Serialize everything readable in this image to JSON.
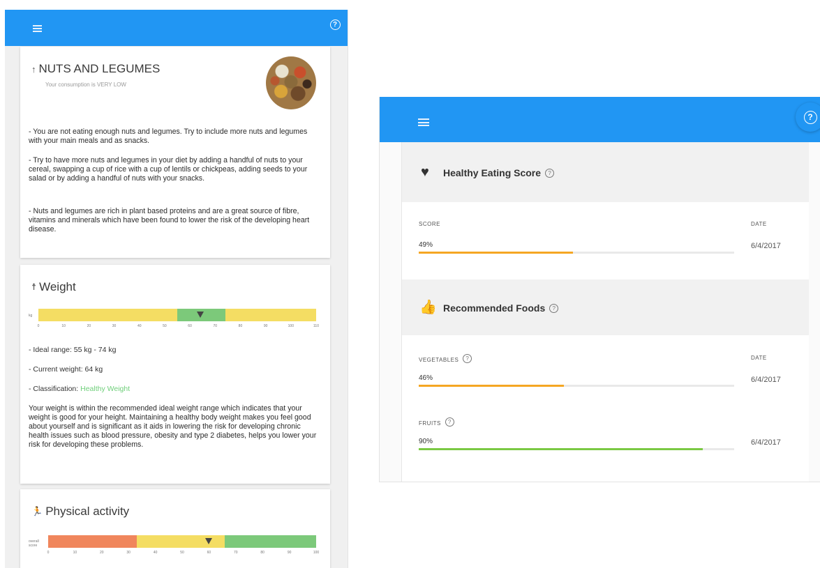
{
  "left": {
    "nuts": {
      "title": "NUTS AND LEGUMES",
      "icon": "arrow-up-icon",
      "subtitle": "Your consumption is VERY LOW",
      "paragraphs": [
        "- You are not eating enough nuts and legumes. Try to include more nuts and legumes with your main meals and as snacks.",
        "- Try to have more nuts and legumes in your diet by adding a handful of nuts to your cereal, swapping a cup of rice with a cup of lentils or chickpeas, adding seeds to your salad or by adding a handful of nuts with your snacks.",
        "- Nuts and legumes are rich in plant based proteins and are a great source of fibre, vitamins and minerals which have been found to lower the risk of the developing heart disease."
      ]
    },
    "weight": {
      "title": "Weight",
      "icon": "person-icon",
      "scale_label": "kg",
      "ticks": [
        "0",
        "10",
        "20",
        "30",
        "40",
        "50",
        "60",
        "70",
        "80",
        "90",
        "100",
        "110"
      ],
      "scale_min": 0,
      "scale_max": 110,
      "ideal_min": 55,
      "ideal_max": 74,
      "current": 64,
      "lines": {
        "ideal_range": "- Ideal range: 55 kg - 74 kg",
        "current_weight": "- Current weight: 64 kg",
        "classification_prefix": "- Classification: ",
        "classification_value": "Healthy Weight"
      },
      "description": "Your weight is within the recommended ideal weight range which indicates that your weight is good for your height. Maintaining a healthy body weight makes you feel good about yourself and is significant as it aids in lowering the risk for developing chronic health issues such as blood pressure, obesity and type 2 diabetes, helps you lower your risk for developing these problems."
    },
    "activity": {
      "title": "Physical activity",
      "icon": "running-person-icon",
      "scale_label": "overall score",
      "ticks": [
        "0",
        "10",
        "20",
        "30",
        "40",
        "50",
        "60",
        "70",
        "80",
        "90",
        "100"
      ],
      "scale_min": 0,
      "scale_max": 100,
      "low_max": 33,
      "mid_max": 66,
      "current": 60
    }
  },
  "right": {
    "healthy_eating": {
      "title": "Healthy Eating Score",
      "icon": "heart-icon",
      "score_label": "SCORE",
      "date_label": "DATE",
      "score_text": "49%",
      "score": 49,
      "date": "6/4/2017"
    },
    "recommended": {
      "title": "Recommended Foods",
      "icon": "thumbs-up-icon",
      "items": [
        {
          "label": "VEGETABLES",
          "date_label": "DATE",
          "percent_text": "46%",
          "percent": 46,
          "date": "6/4/2017"
        },
        {
          "label": "FRUITS",
          "date_label": "",
          "percent_text": "90%",
          "percent": 90,
          "date": "6/4/2017"
        }
      ]
    }
  },
  "help_symbol": "?",
  "colors": {
    "appbar": "#2196f3",
    "orange": "#f5a623",
    "green": "#7ac943",
    "scale_yellow": "#f4dd63",
    "scale_green": "#7cc97a",
    "scale_red": "#f0865c"
  }
}
